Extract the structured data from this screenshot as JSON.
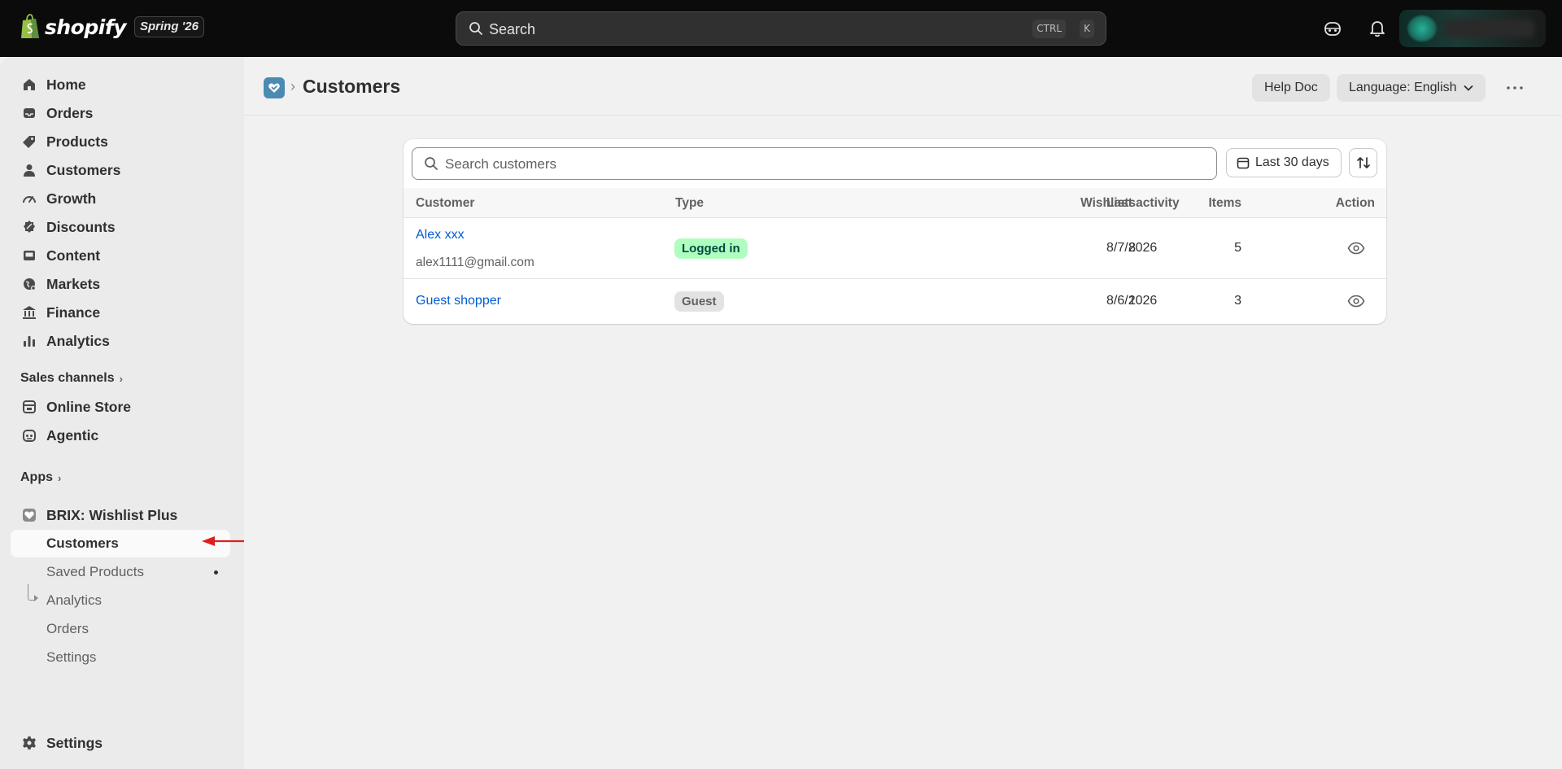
{
  "topbar": {
    "brand": "shopify",
    "edition": "Spring '26",
    "search_label": "Search",
    "kbd_ctrl": "CTRL",
    "kbd_k": "K"
  },
  "sidebar": {
    "items": [
      {
        "label": "Home",
        "icon": "home-icon"
      },
      {
        "label": "Orders",
        "icon": "inbox-icon"
      },
      {
        "label": "Products",
        "icon": "tag-icon"
      },
      {
        "label": "Customers",
        "icon": "person-icon"
      },
      {
        "label": "Growth",
        "icon": "gauge-icon"
      },
      {
        "label": "Discounts",
        "icon": "discount-icon"
      },
      {
        "label": "Content",
        "icon": "image-icon"
      },
      {
        "label": "Markets",
        "icon": "globe-icon"
      },
      {
        "label": "Finance",
        "icon": "bank-icon"
      },
      {
        "label": "Analytics",
        "icon": "bar-chart-icon"
      }
    ],
    "sales_channels_heading": "Sales channels",
    "channels": [
      {
        "label": "Online Store",
        "icon": "store-icon"
      },
      {
        "label": "Agentic",
        "icon": "robot-icon"
      }
    ],
    "apps_heading": "Apps",
    "app_name": "BRIX: Wishlist Plus",
    "app_sub": [
      {
        "label": "Customers",
        "active": true
      },
      {
        "label": "Saved Products"
      },
      {
        "label": "Analytics"
      },
      {
        "label": "Orders"
      },
      {
        "label": "Settings"
      }
    ],
    "settings_label": "Settings"
  },
  "header": {
    "title": "Customers",
    "help_label": "Help Doc",
    "language_label": "Language: English"
  },
  "customers": {
    "search_placeholder": "Search customers",
    "date_range_label": "Last 30 days",
    "columns": {
      "customer": "Customer",
      "type": "Type",
      "wishlists": "Wishlists",
      "items": "Items",
      "last_activity": "Last activity",
      "action": "Action"
    },
    "rows": [
      {
        "name": "Alex xxx",
        "email": "alex1111@gmail.com",
        "type": "Logged in",
        "wishlists": "8",
        "items": "5",
        "last_activity": "8/7/2026"
      },
      {
        "name": "Guest shopper",
        "type": "Guest",
        "wishlists": "1",
        "items": "3",
        "last_activity": "8/6/2026"
      }
    ]
  },
  "colors": {
    "topbar": "#0b0b0b",
    "link": "#005bd3",
    "badge_green": "#affebf",
    "annotation_arrow": "#e01e1e"
  }
}
